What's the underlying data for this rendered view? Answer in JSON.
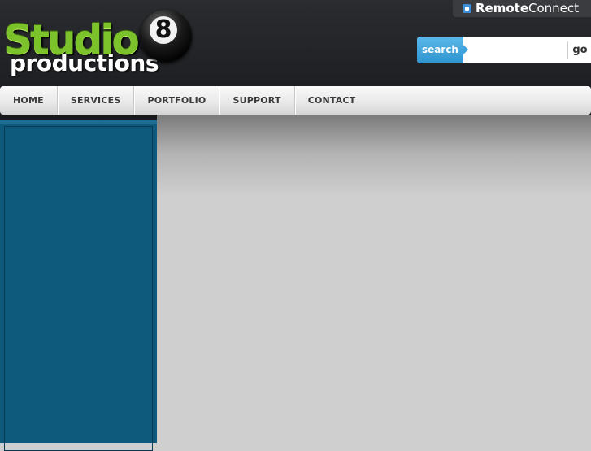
{
  "logo": {
    "word1": "Studio",
    "word2": "productions",
    "ball_number": "8"
  },
  "remote": {
    "label_bold": "Remote",
    "label_rest": "Connect"
  },
  "search": {
    "label": "search",
    "value": "",
    "go_label": "go"
  },
  "nav": [
    "HOME",
    "SERVICES",
    "PORTFOLIO",
    "SUPPORT",
    "CONTACT"
  ],
  "colors": {
    "brand_green": "#7cc22b",
    "accent_blue": "#2e93cf",
    "sidebar": "#0d5a7d",
    "header": "#1f2124"
  }
}
